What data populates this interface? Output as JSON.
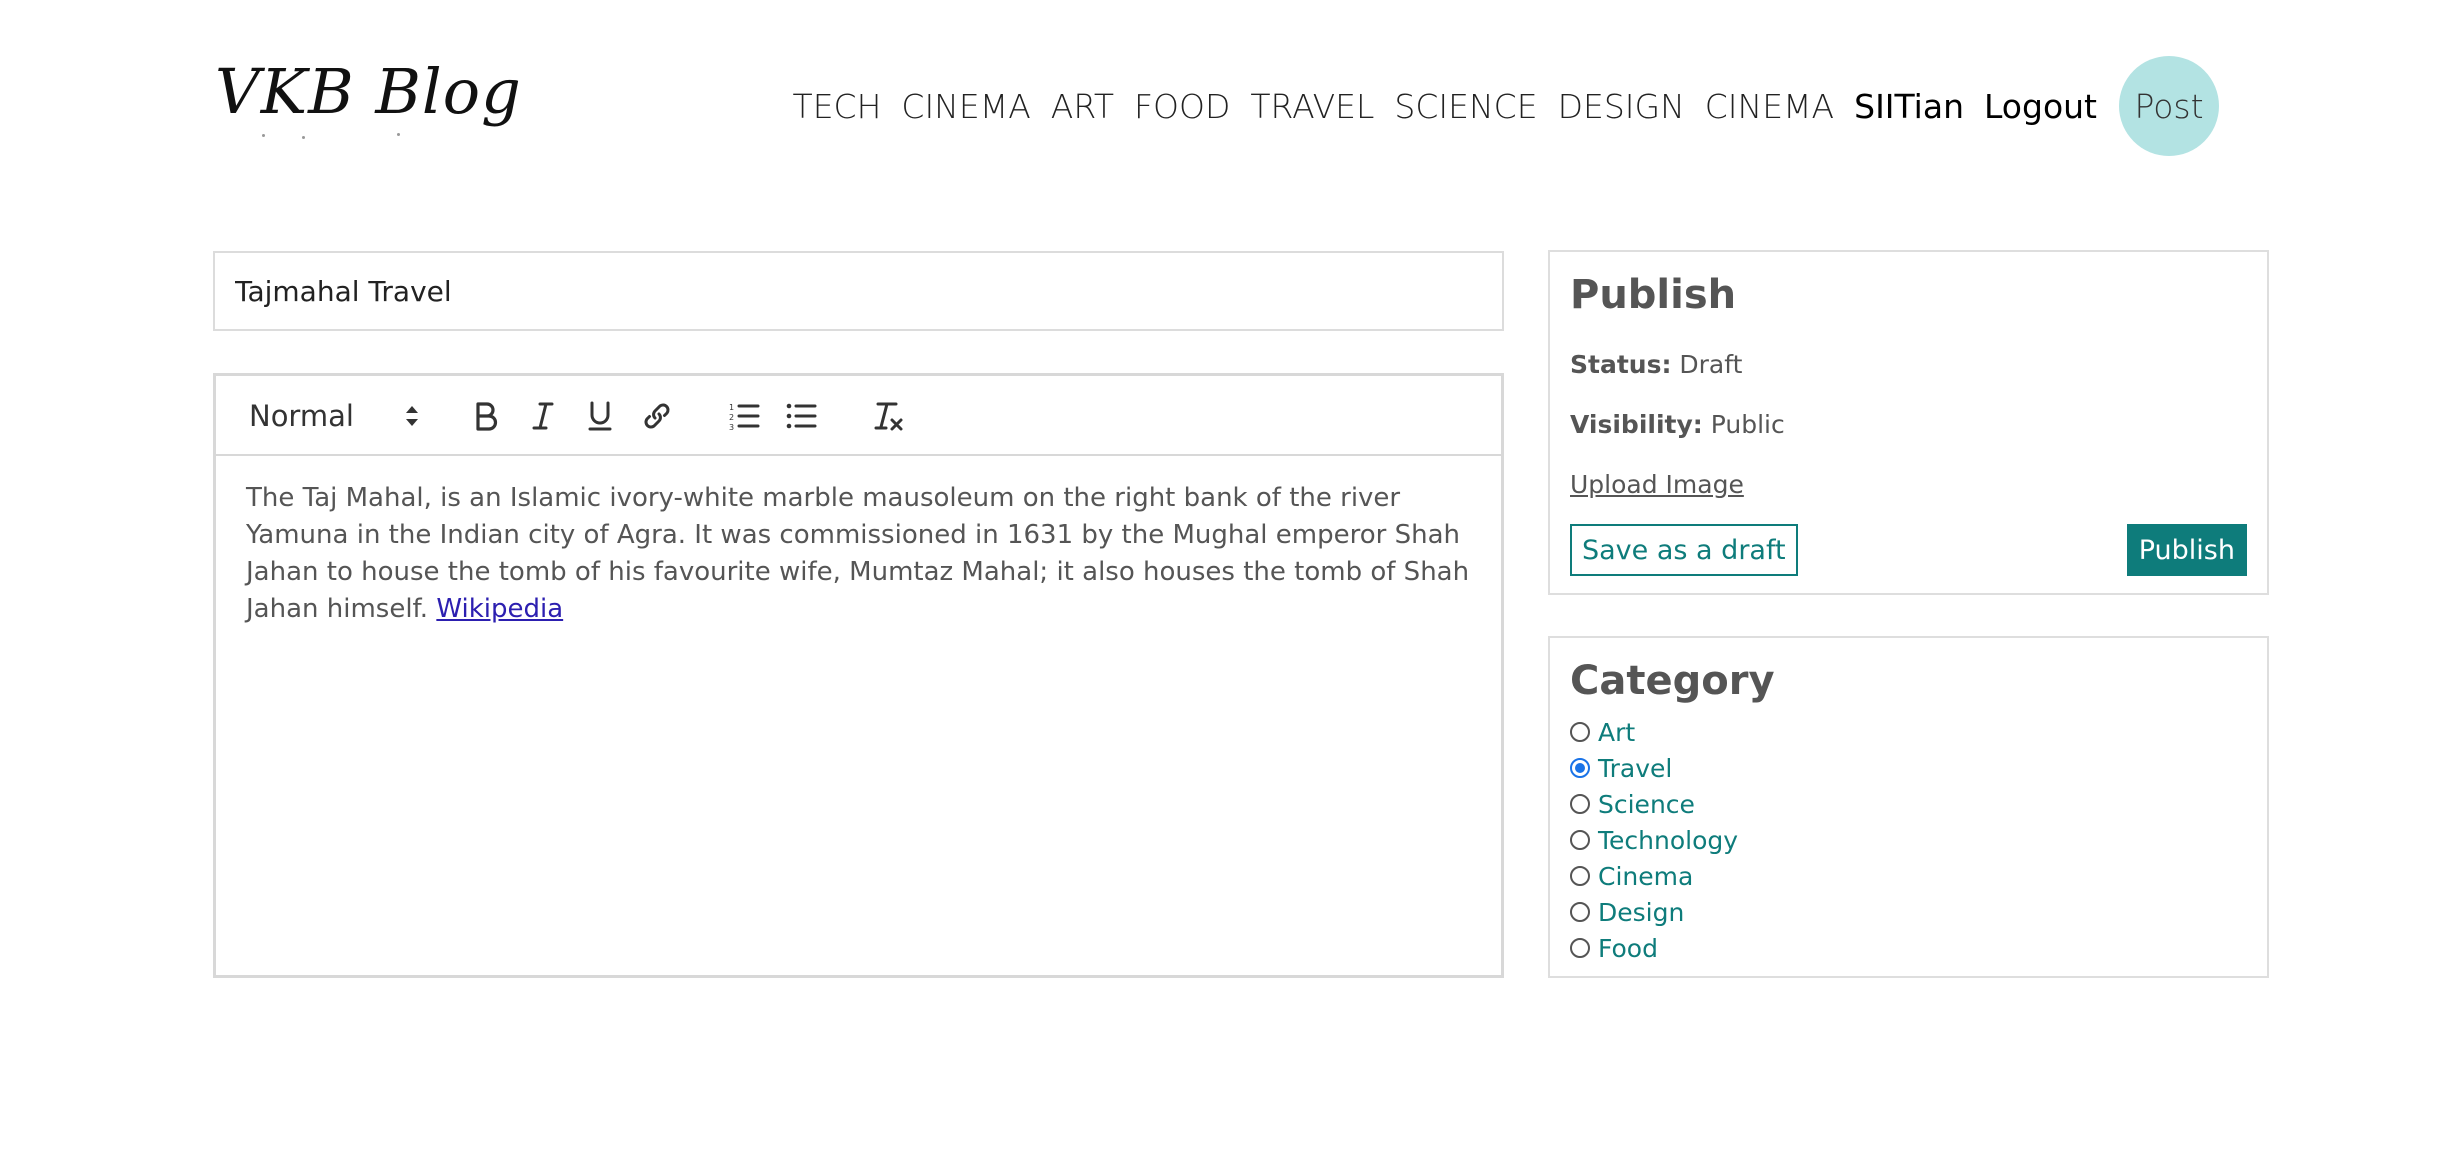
{
  "header": {
    "logo": "VKB Blog",
    "nav": [
      "TECH",
      "CINEMA",
      "ART",
      "FOOD",
      "TRAVEL",
      "SCIENCE",
      "DESIGN",
      "CINEMA"
    ],
    "username": "SIITian",
    "logout": "Logout",
    "post": "Post"
  },
  "post_title": {
    "value": "Tajmahal Travel"
  },
  "editor": {
    "format_select": "Normal",
    "toolbar_icons": [
      "bold-icon",
      "italic-icon",
      "underline-icon",
      "link-icon",
      "ordered-list-icon",
      "bullet-list-icon",
      "clear-format-icon"
    ],
    "body_text": "The Taj Mahal, is an Islamic ivory-white marble mausoleum on the right bank of the river Yamuna in the Indian city of Agra. It was commissioned in 1631 by the Mughal emperor Shah Jahan to house the tomb of his favourite wife, Mumtaz Mahal; it also houses the tomb of Shah Jahan himself.",
    "link_text": "Wikipedia"
  },
  "publish": {
    "heading": "Publish",
    "status_label": "Status:",
    "status_value": "Draft",
    "visibility_label": "Visibility:",
    "visibility_value": "Public",
    "upload_label": "Upload Image",
    "save_draft_label": "Save as a draft",
    "publish_label": "Publish"
  },
  "category": {
    "heading": "Category",
    "options": [
      "Art",
      "Travel",
      "Science",
      "Technology",
      "Cinema",
      "Design",
      "Food"
    ],
    "selected": "Travel"
  },
  "colors": {
    "accent": "#0e7c7b",
    "post_circle": "#b3e3e3",
    "link": "#2c1fb0",
    "radio_selected": "#1a73e8"
  }
}
